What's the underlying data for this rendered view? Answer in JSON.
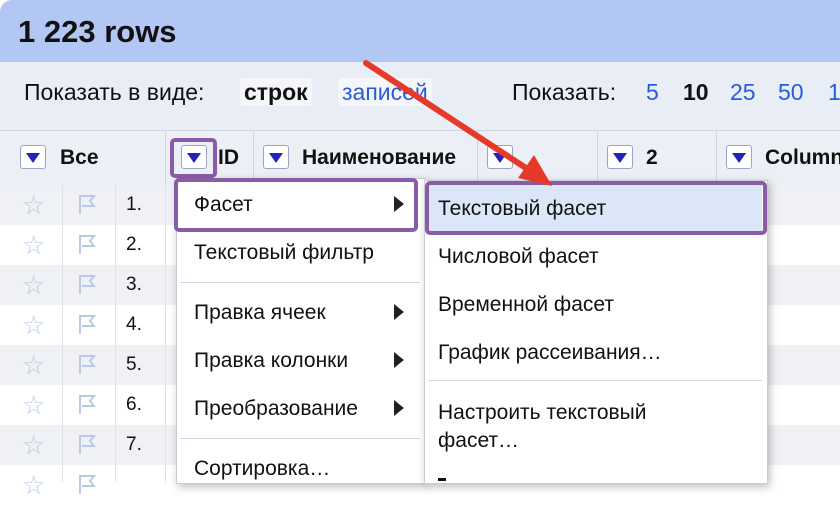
{
  "header": {
    "title": "1 223 rows"
  },
  "viewbar": {
    "show_as_label": "Показать в виде:",
    "mode_rows": "строк",
    "mode_records": "записей",
    "show_label": "Показать:",
    "page_sizes": [
      "5",
      "10",
      "25",
      "50",
      "1"
    ],
    "selected_page_size": "10"
  },
  "columns": {
    "all": "Все",
    "id": "ID",
    "name": "Наименование",
    "col2": "2",
    "column": "Column"
  },
  "rows": [
    "1.",
    "2.",
    "3.",
    "4.",
    "5.",
    "6.",
    "7."
  ],
  "menu": {
    "facet": "Фасет",
    "text_filter": "Текстовый фильтр",
    "edit_cells": "Правка ячеек",
    "edit_column": "Правка колонки",
    "transform": "Преобразование",
    "sort": "Сортировка…"
  },
  "submenu": {
    "text_facet": "Текстовый фасет",
    "numeric_facet": "Числовой фасет",
    "timeline_facet": "Временной фасет",
    "scatterplot": "График рассеивания…",
    "custom_text_facet_line1": "Настроить текстовый",
    "custom_text_facet_line2": "фасет…"
  },
  "colors": {
    "header_bg": "#b3c7f5",
    "link": "#2a5bd7",
    "highlight": "#8a5ca6",
    "arrow": "#e53a2a"
  }
}
